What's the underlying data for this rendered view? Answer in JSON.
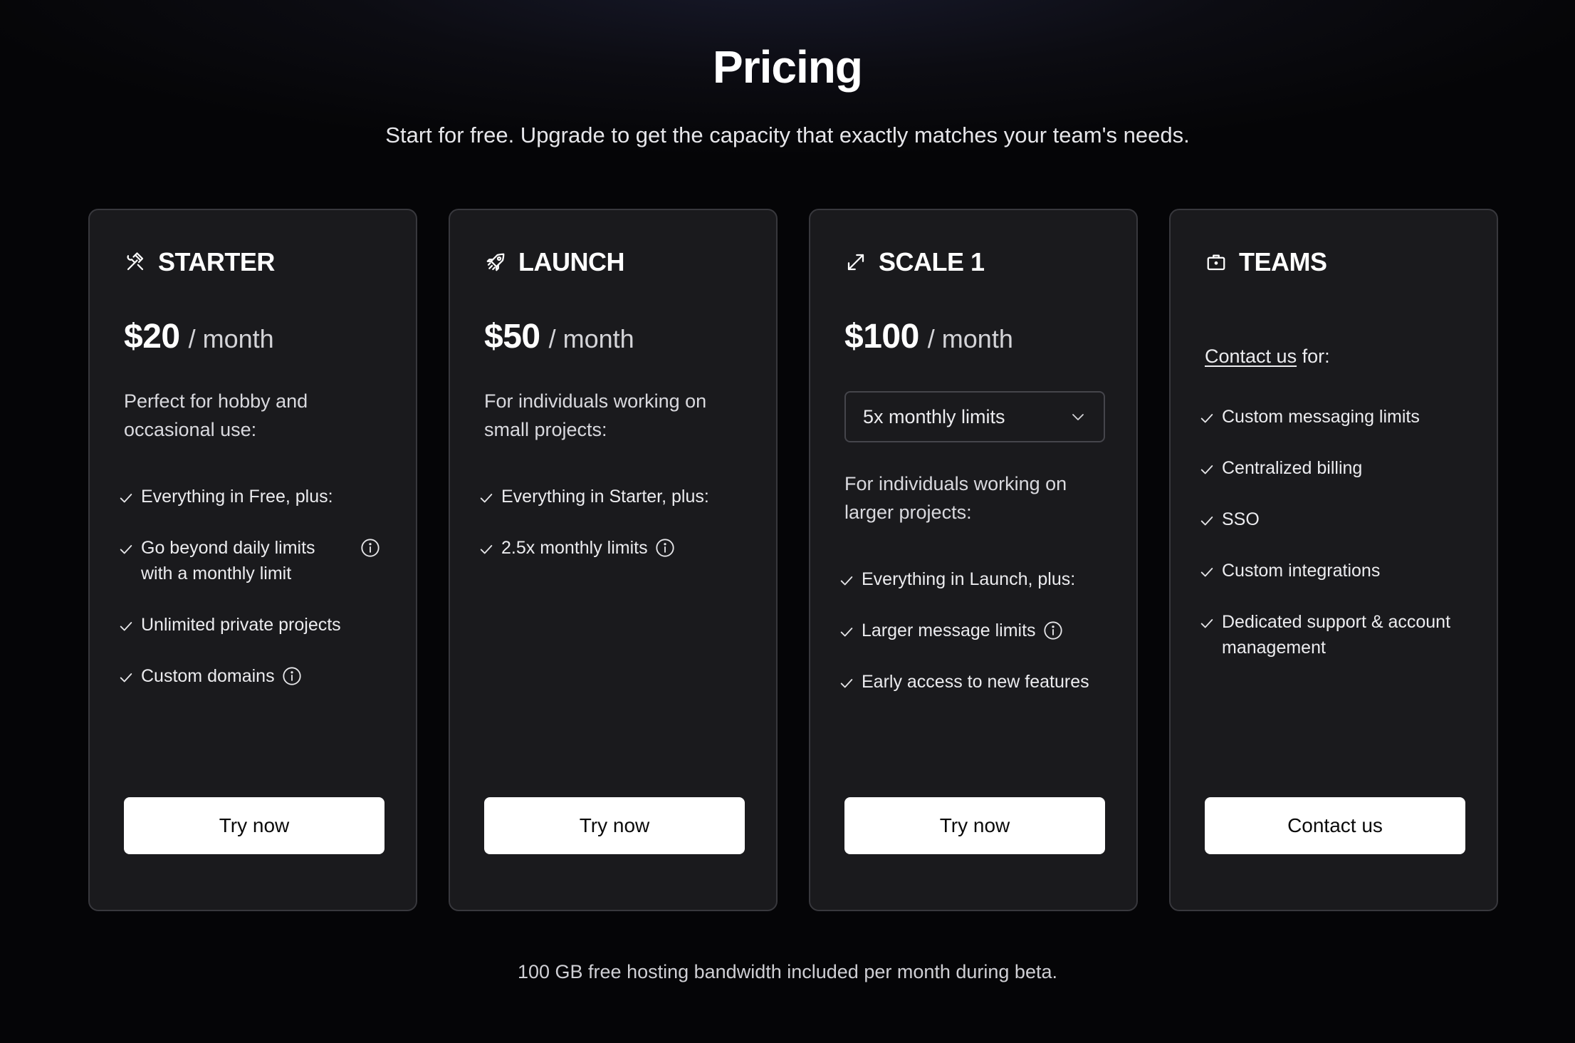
{
  "header": {
    "title": "Pricing",
    "subtitle": "Start for free. Upgrade to get the capacity that exactly matches your team's needs."
  },
  "plans": [
    {
      "name": "STARTER",
      "icon": "hammer-wrench-icon",
      "price": "$20",
      "period": "/ month",
      "description": "Perfect for hobby and occasional use:",
      "features": [
        "Everything in Free, plus:",
        "Go beyond daily limits with a monthly limit",
        "Unlimited private projects",
        "Custom domains"
      ],
      "cta": "Try now"
    },
    {
      "name": "LAUNCH",
      "icon": "rocket-icon",
      "price": "$50",
      "period": "/ month",
      "description": "For individuals working on small projects:",
      "features": [
        "Everything in Starter, plus:",
        "2.5x monthly limits"
      ],
      "cta": "Try now"
    },
    {
      "name": "SCALE 1",
      "icon": "expand-arrows-icon",
      "price": "$100",
      "period": "/ month",
      "select_value": "5x monthly limits",
      "description": "For individuals working on larger projects:",
      "features": [
        "Everything in Launch, plus:",
        "Larger message limits",
        "Early access to new features"
      ],
      "cta": "Try now"
    },
    {
      "name": "TEAMS",
      "icon": "briefcase-icon",
      "contact_link": "Contact us",
      "contact_suffix": " for:",
      "features": [
        "Custom messaging limits",
        "Centralized billing",
        "SSO",
        "Custom integrations",
        "Dedicated support & account management"
      ],
      "cta": "Contact us"
    }
  ],
  "footer": {
    "note": "100 GB free hosting bandwidth included per month during beta."
  },
  "colors": {
    "background": "#060608",
    "card": "#1a1a1d",
    "card_border": "#38383d",
    "button": "#ffffff",
    "button_text": "#0a0a0a"
  }
}
